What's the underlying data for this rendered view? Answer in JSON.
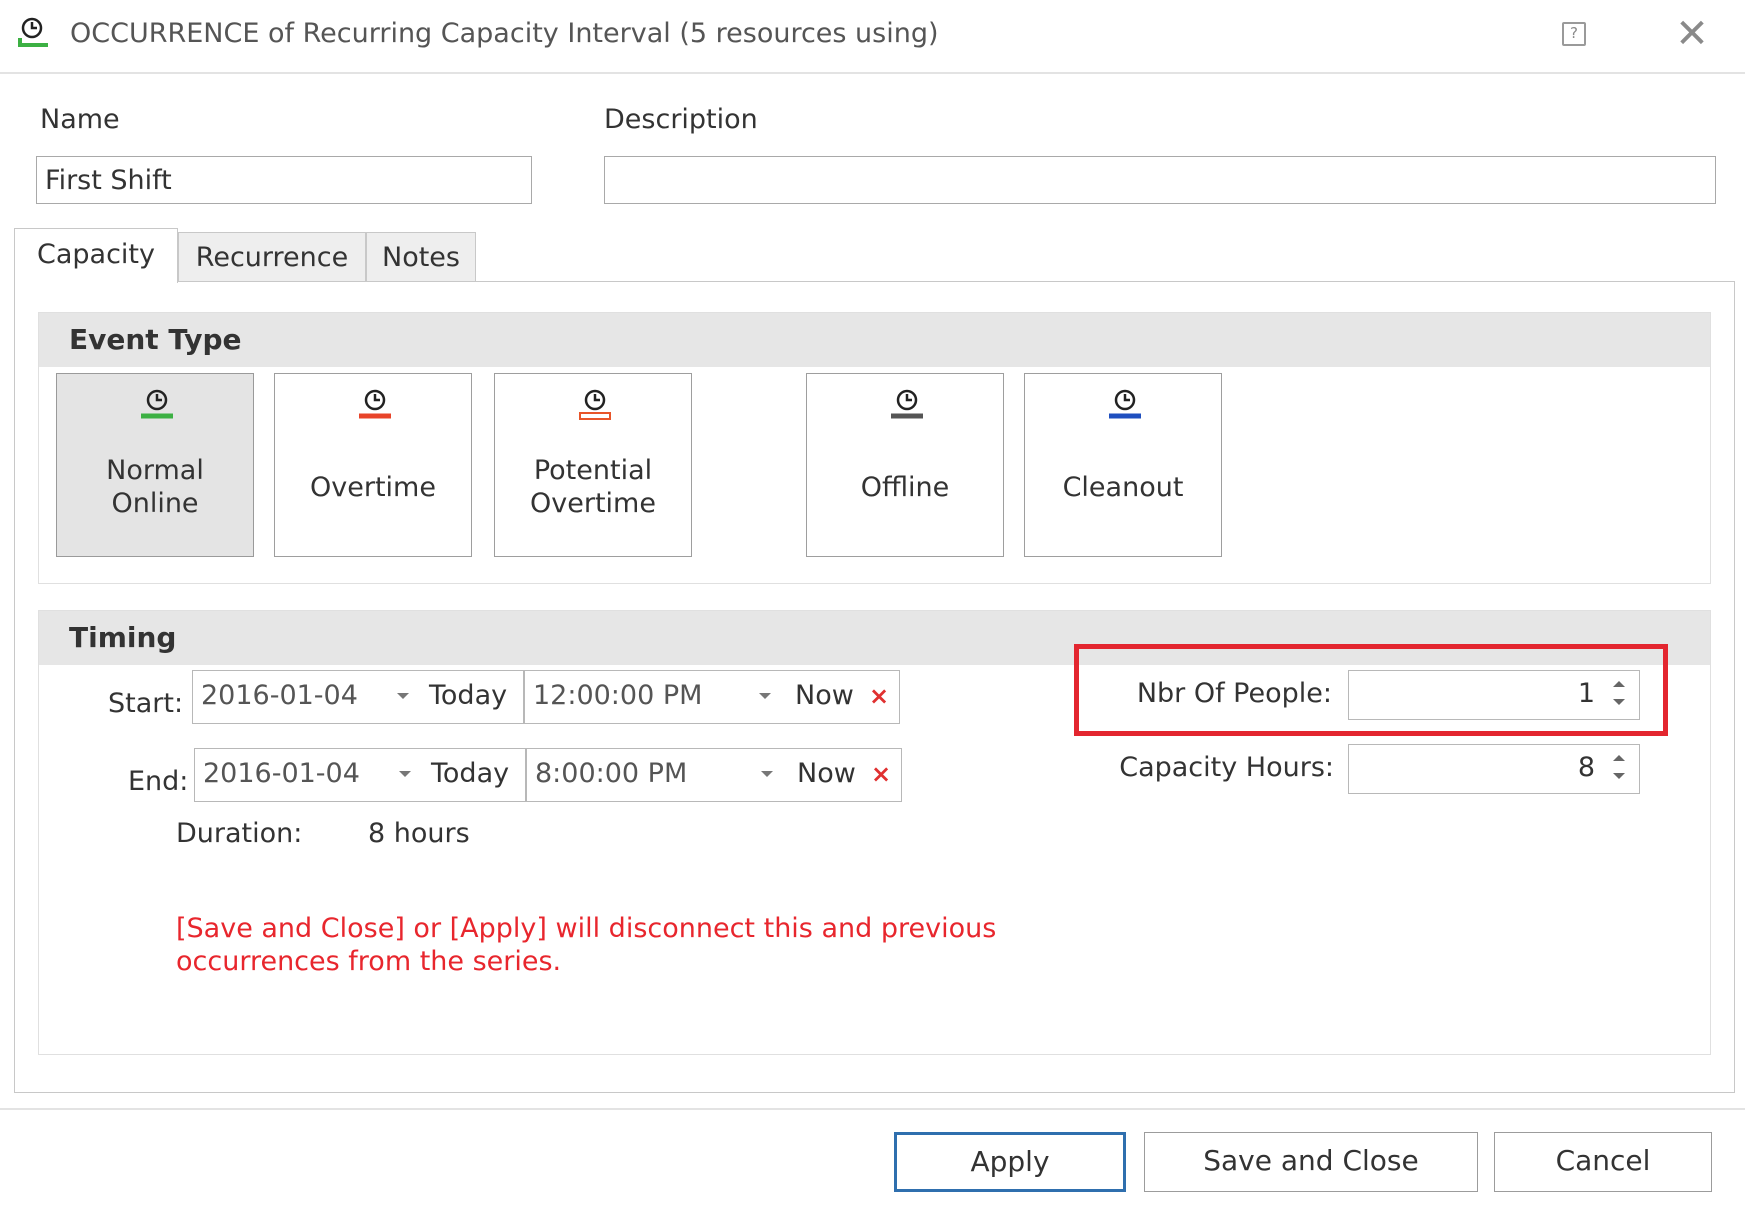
{
  "window": {
    "title": "OCCURRENCE of Recurring Capacity Interval (5 resources using)",
    "title_icon": "clock-icon",
    "help_icon": "help-icon",
    "close_icon": "close-icon"
  },
  "form": {
    "name_label": "Name",
    "name_value": "First Shift",
    "description_label": "Description",
    "description_value": ""
  },
  "tabs": [
    {
      "label": "Capacity",
      "active": true
    },
    {
      "label": "Recurrence",
      "active": false
    },
    {
      "label": "Notes",
      "active": false
    }
  ],
  "event_type": {
    "heading": "Event Type",
    "options": [
      {
        "line1": "Normal",
        "line2": "Online",
        "color": "#3cb043",
        "selected": true
      },
      {
        "line1": "Overtime",
        "line2": "",
        "color": "#e8442a",
        "selected": false
      },
      {
        "line1": "Potential",
        "line2": "Overtime",
        "color": "#e8552a",
        "selected": false
      },
      {
        "line1": "Offline",
        "line2": "",
        "color": "#555555",
        "selected": false
      },
      {
        "line1": "Cleanout",
        "line2": "",
        "color": "#1f4fbf",
        "selected": false
      }
    ]
  },
  "timing": {
    "heading": "Timing",
    "start_label": "Start:",
    "start_date": "2016-01-04",
    "start_today": "Today",
    "start_time": "12:00:00 PM",
    "start_now": "Now",
    "end_label": "End:",
    "end_date": "2016-01-04",
    "end_today": "Today",
    "end_time": "8:00:00 PM",
    "end_now": "Now",
    "clear_symbol": "×",
    "duration_label": "Duration:",
    "duration_value": "8 hours",
    "warning_line1": "[Save and Close] or [Apply] will disconnect this and previous",
    "warning_line2": "occurrences from the series.",
    "nbr_people_label": "Nbr Of People:",
    "nbr_people_value": "1",
    "capacity_hours_label": "Capacity Hours:",
    "capacity_hours_value": "8",
    "highlight_color": "#e3262f"
  },
  "footer": {
    "apply": "Apply",
    "save_close": "Save and Close",
    "cancel": "Cancel"
  }
}
